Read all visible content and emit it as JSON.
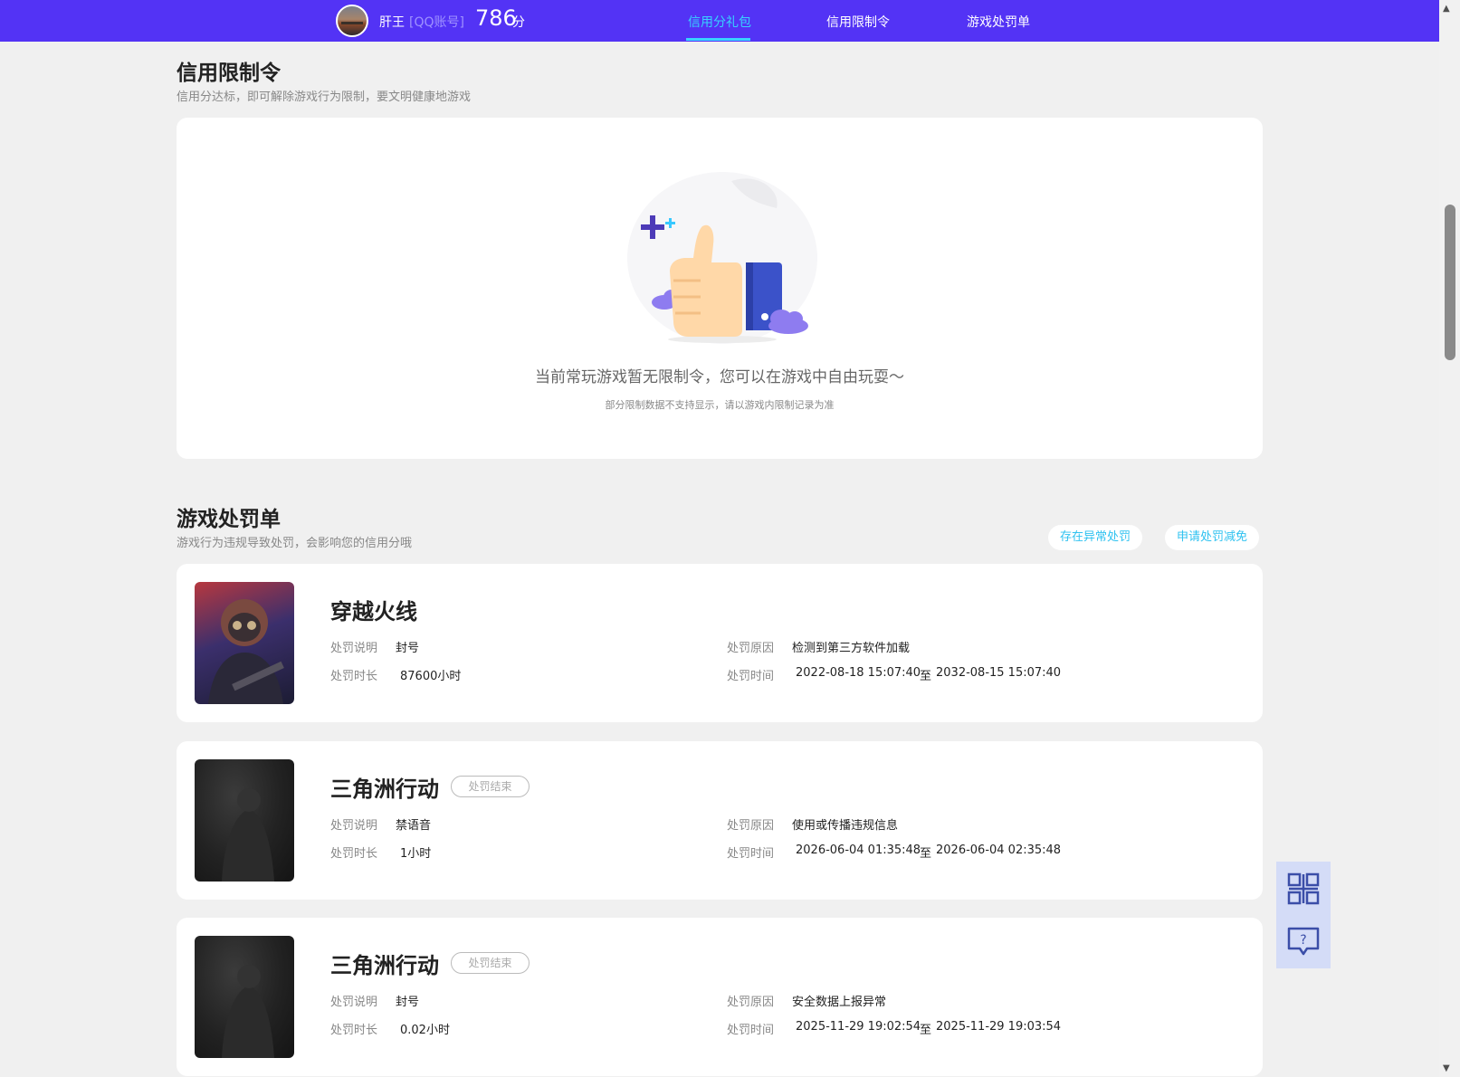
{
  "header": {
    "user_name": "肝王",
    "account_type": "[QQ账号]",
    "score": "786",
    "score_unit": "分",
    "tabs": [
      {
        "label": "信用分礼包",
        "active": true
      },
      {
        "label": "信用限制令",
        "active": false
      },
      {
        "label": "游戏处罚单",
        "active": false
      }
    ],
    "accent_color": "#5333f5",
    "active_tab_color": "#37d3ff"
  },
  "restriction": {
    "title": "信用限制令",
    "subtitle": "信用分达标，即可解除游戏行为限制，要文明健康地游戏",
    "empty_message": "当前常玩游戏暂无限制令，您可以在游戏中自由玩耍～",
    "empty_note": "部分限制数据不支持显示，请以游戏内限制记录为准",
    "illustration_icon": "thumbs-up-icon"
  },
  "penalties": {
    "title": "游戏处罚单",
    "subtitle": "游戏行为违规导致处罚，会影响您的信用分哦",
    "actions": [
      "存在异常处罚",
      "申请处罚减免"
    ],
    "labels": {
      "desc": "处罚说明",
      "duration": "处罚时长",
      "reason": "处罚原因",
      "time": "处罚时间",
      "to": "至"
    },
    "items": [
      {
        "game": "穿越火线",
        "status": "",
        "desc": "封号",
        "duration": "87600小时",
        "reason": "检测到第三方软件加载",
        "start": "2022-08-18 15:07:40",
        "end": "2032-08-15 15:07:40"
      },
      {
        "game": "三角洲行动",
        "status": "处罚结束",
        "desc": "禁语音",
        "duration": "1小时",
        "reason": "使用或传播违规信息",
        "start": "2026-06-04 01:35:48",
        "end": "2026-06-04 02:35:48"
      },
      {
        "game": "三角洲行动",
        "status": "处罚结束",
        "desc": "封号",
        "duration": "0.02小时",
        "reason": "安全数据上报异常",
        "start": "2025-11-29 19:02:54",
        "end": "2025-11-29 19:03:54"
      }
    ]
  },
  "side_tools": [
    {
      "icon": "qr-code-icon"
    },
    {
      "icon": "help-chat-icon"
    }
  ]
}
